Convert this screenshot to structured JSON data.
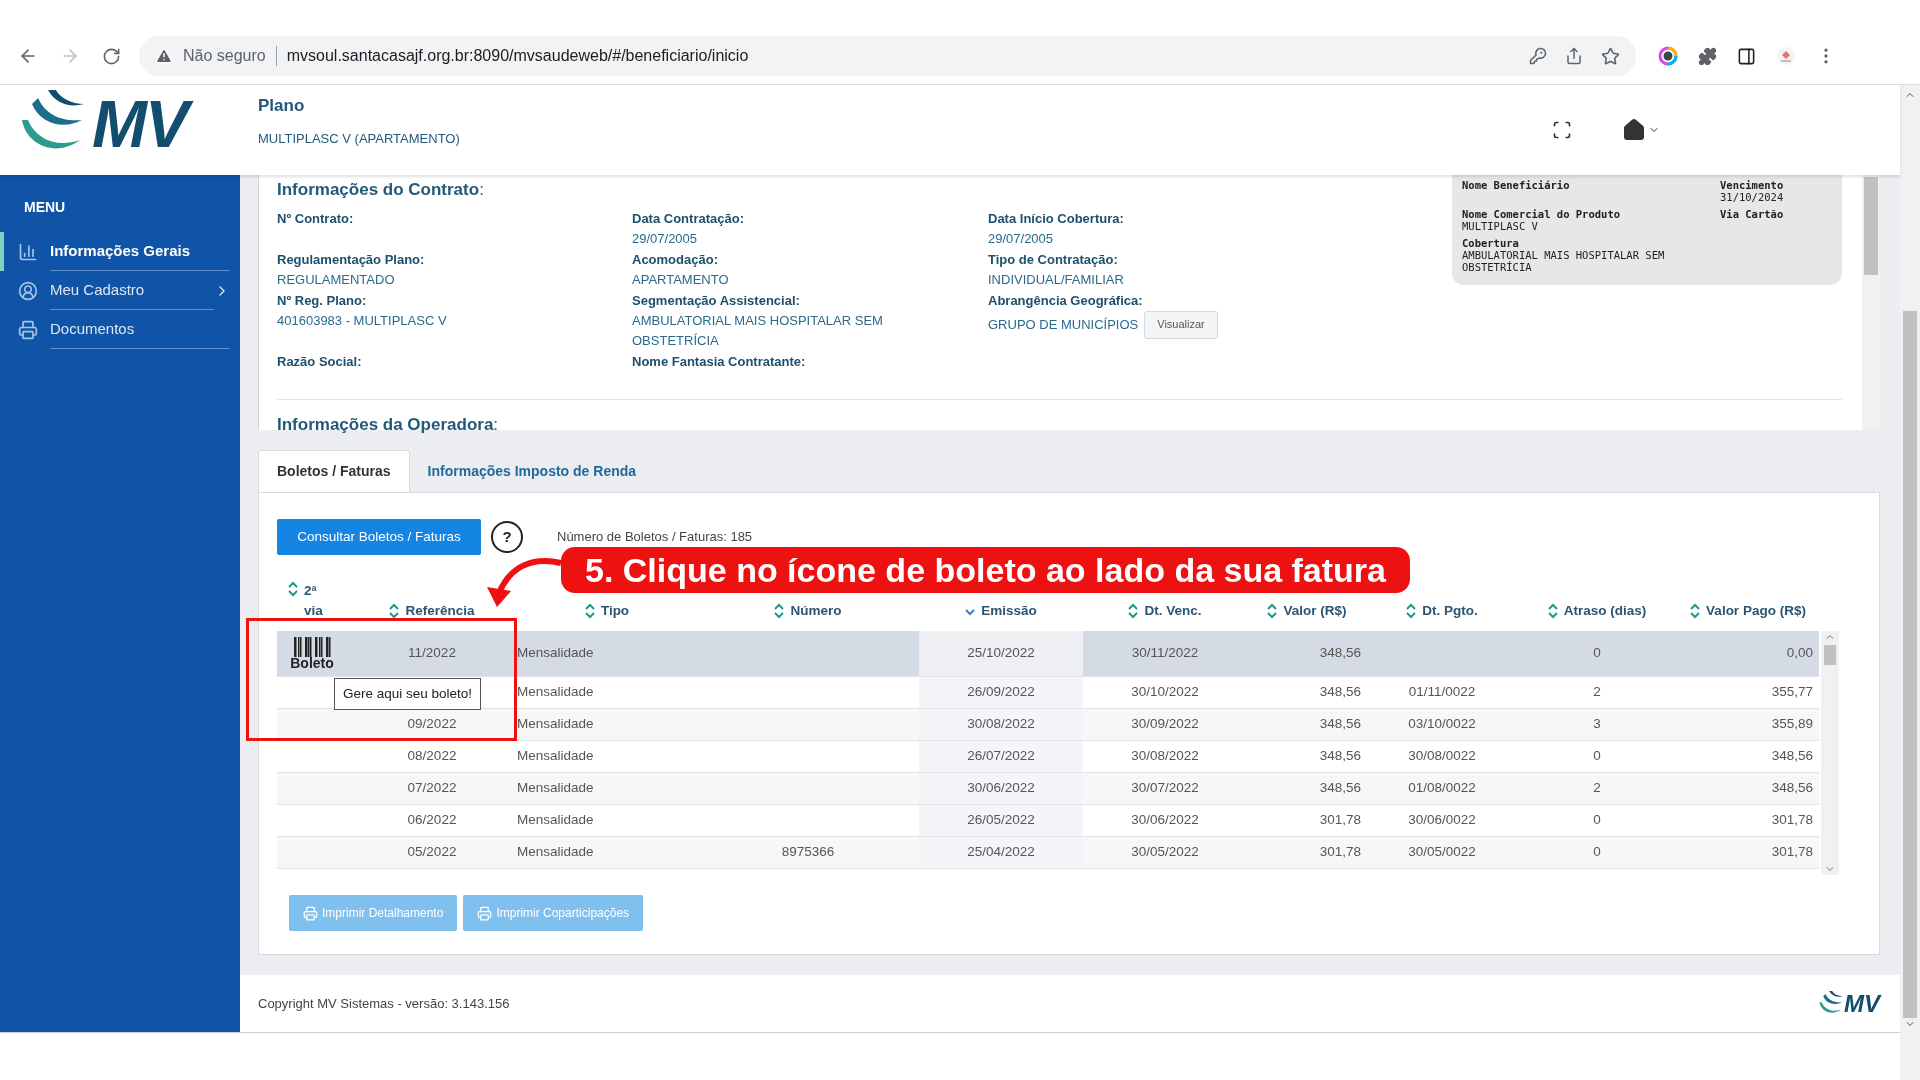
{
  "browser": {
    "security": "Não seguro",
    "url": "mvsoul.santacasajf.org.br:8090/mvsaudeweb/#/beneficiario/inicio"
  },
  "header": {
    "logo": "MV",
    "plan_label": "Plano",
    "plan_value": "MULTIPLASC V (APARTAMENTO)"
  },
  "sidebar": {
    "title": "MENU",
    "items": [
      {
        "label": "Informações Gerais",
        "kind": "chart",
        "selected": true,
        "expandable": false
      },
      {
        "label": "Meu Cadastro",
        "kind": "user",
        "selected": false,
        "expandable": true
      },
      {
        "label": "Documentos",
        "kind": "printer",
        "selected": false,
        "expandable": false
      }
    ]
  },
  "contract": {
    "title": "**Informações do Contrato**:",
    "fields": [
      {
        "label": "Nº Contrato:"
      },
      {
        "label": "Data Contratação:",
        "value": "29/07/2005"
      },
      {
        "label": "Data Início Cobertura:",
        "value": "29/07/2005"
      },
      {
        "label": "Regulamentação Plano:",
        "value": "REGULAMENTADO"
      },
      {
        "label": "Acomodação:",
        "value": "APARTAMENTO"
      },
      {
        "label": "Tipo de Contratação:",
        "value": "INDIVIDUAL/FAMILIAR"
      },
      {
        "label": "Nº Reg. Plano:",
        "value": "401603983 - MULTIPLASC V"
      },
      {
        "label": "Segmentação Assistencial:",
        "value": "AMBULATORIAL MAIS HOSPITALAR SEM OBSTETRÍCIA"
      },
      {
        "label": "Abrangência Geográfica:",
        "value": "GRUPO DE MUNICÍPIOS",
        "action": "Visualizar"
      },
      {
        "label": "Razão Social:"
      },
      {
        "label": "Nome Fantasia Contratante:"
      }
    ],
    "card": [
      {
        "label": "Nome Beneficiário"
      },
      {
        "label": "Vencimento",
        "value": "31/10/2024"
      },
      {
        "label": "Nome Comercial do Produto",
        "value": "MULTIPLASC V"
      },
      {
        "label": "Via Cartão"
      },
      {
        "label": "Cobertura",
        "value": "AMBULATORIAL MAIS HOSPITALAR SEM OBSTETRÍCIA"
      }
    ],
    "operator_title": "**Informações da Operadora**:"
  },
  "tabs": [
    {
      "label": "Boletos / Faturas",
      "selected": true
    },
    {
      "label": "Informações Imposto de Renda",
      "selected": false
    }
  ],
  "toolbar": {
    "button": "Consultar Boletos / Faturas",
    "help": "?",
    "count": "Número de Boletos / Faturas: 185"
  },
  "table": {
    "columns": [
      {
        "label": "2ª via",
        "sorted": false
      },
      {
        "label": "Referência",
        "sorted": false
      },
      {
        "label": "Tipo",
        "sorted": false
      },
      {
        "label": "Número",
        "sorted": false
      },
      {
        "label": "Emissão",
        "sorted": true
      },
      {
        "label": "Dt. Venc.",
        "sorted": false
      },
      {
        "label": "Valor (R$)",
        "sorted": false
      },
      {
        "label": "Dt. Pgto.",
        "sorted": false
      },
      {
        "label": "Atraso (dias)",
        "sorted": false
      },
      {
        "label": "Valor Pago (R$)",
        "sorted": false
      }
    ],
    "rows": [
      {
        "selected": true,
        "cells": [
          "Boleto",
          "11/2022",
          "Mensalidade",
          "",
          "25/10/2022",
          "30/11/2022",
          "348,56",
          "",
          "0",
          "0,00"
        ]
      },
      {
        "selected": false,
        "cells": [
          "",
          "",
          "Mensalidade",
          "",
          "26/09/2022",
          "30/10/2022",
          "348,56",
          "01/11/0022",
          "2",
          "355,77"
        ]
      },
      {
        "selected": false,
        "cells": [
          "",
          "09/2022",
          "Mensalidade",
          "",
          "30/08/2022",
          "30/09/2022",
          "348,56",
          "03/10/0022",
          "3",
          "355,89"
        ]
      },
      {
        "selected": false,
        "cells": [
          "",
          "08/2022",
          "Mensalidade",
          "",
          "26/07/2022",
          "30/08/2022",
          "348,56",
          "30/08/0022",
          "0",
          "348,56"
        ]
      },
      {
        "selected": false,
        "cells": [
          "",
          "07/2022",
          "Mensalidade",
          "",
          "30/06/2022",
          "30/07/2022",
          "348,56",
          "01/08/0022",
          "2",
          "348,56"
        ]
      },
      {
        "selected": false,
        "cells": [
          "",
          "06/2022",
          "Mensalidade",
          "",
          "26/05/2022",
          "30/06/2022",
          "301,78",
          "30/06/0022",
          "0",
          "301,78"
        ]
      },
      {
        "selected": false,
        "cells": [
          "",
          "05/2022",
          "Mensalidade",
          "8975366",
          "25/04/2022",
          "30/05/2022",
          "301,78",
          "30/05/0022",
          "0",
          "301,78"
        ]
      }
    ]
  },
  "tooltip": "Gere aqui seu boleto!",
  "print_buttons": [
    {
      "label": "Imprimir Detalhamento",
      "disabled": true
    },
    {
      "label": "Imprimir Coparticipações",
      "disabled": true
    }
  ],
  "annotation": "5. Clique no ícone de boleto ao lado da sua fatura",
  "footer": {
    "copyright": "Copyright MV Sistemas - versão: 3.143.156",
    "logo": "MV"
  }
}
